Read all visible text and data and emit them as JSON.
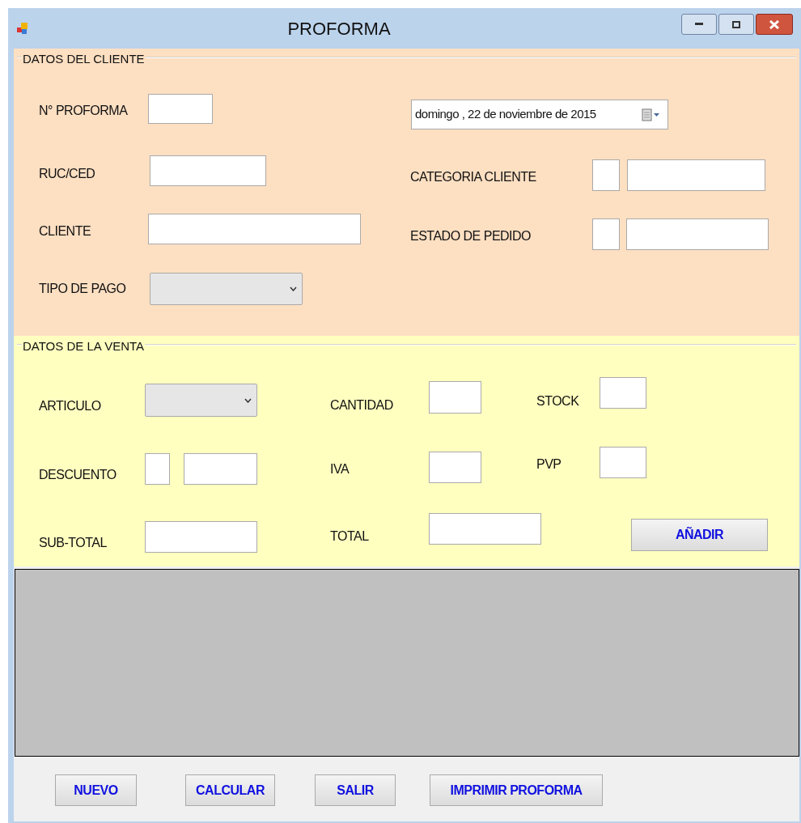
{
  "window": {
    "title": "PROFORMA"
  },
  "groups": [
    {
      "title": "DATOS DEL CLIENTE",
      "items": [
        {
          "kind": "label",
          "text": "N° PROFORMA"
        },
        {
          "kind": "text"
        },
        {
          "kind": "date",
          "value": "domingo , 22 de noviembre de 2015"
        },
        {
          "kind": "label",
          "text": "RUC/CED"
        },
        {
          "kind": "text"
        },
        {
          "kind": "label",
          "text": "CATEGORIA CLIENTE"
        },
        {
          "kind": "text"
        },
        {
          "kind": "text"
        },
        {
          "kind": "label",
          "text": "CLIENTE"
        },
        {
          "kind": "text"
        },
        {
          "kind": "label",
          "text": "ESTADO DE PEDIDO"
        },
        {
          "kind": "text"
        },
        {
          "kind": "text"
        },
        {
          "kind": "label",
          "text": "TIPO DE PAGO"
        },
        {
          "kind": "combo"
        }
      ]
    },
    {
      "title": "DATOS DE LA VENTA",
      "items": [
        {
          "kind": "label",
          "text": "ARTICULO"
        },
        {
          "kind": "combo"
        },
        {
          "kind": "label",
          "text": "CANTIDAD"
        },
        {
          "kind": "text"
        },
        {
          "kind": "label",
          "text": "STOCK"
        },
        {
          "kind": "text"
        },
        {
          "kind": "label",
          "text": "DESCUENTO"
        },
        {
          "kind": "text"
        },
        {
          "kind": "text"
        },
        {
          "kind": "label",
          "text": "IVA"
        },
        {
          "kind": "text"
        },
        {
          "kind": "label",
          "text": "PVP"
        },
        {
          "kind": "text"
        },
        {
          "kind": "label",
          "text": "SUB-TOTAL"
        },
        {
          "kind": "text"
        },
        {
          "kind": "label",
          "text": "TOTAL"
        },
        {
          "kind": "text"
        },
        {
          "kind": "button",
          "text": "AÑADIR"
        }
      ]
    }
  ],
  "buttons": [
    "NUEVO",
    "CALCULAR",
    "SALIR",
    "IMPRIMIR PROFORMA"
  ]
}
